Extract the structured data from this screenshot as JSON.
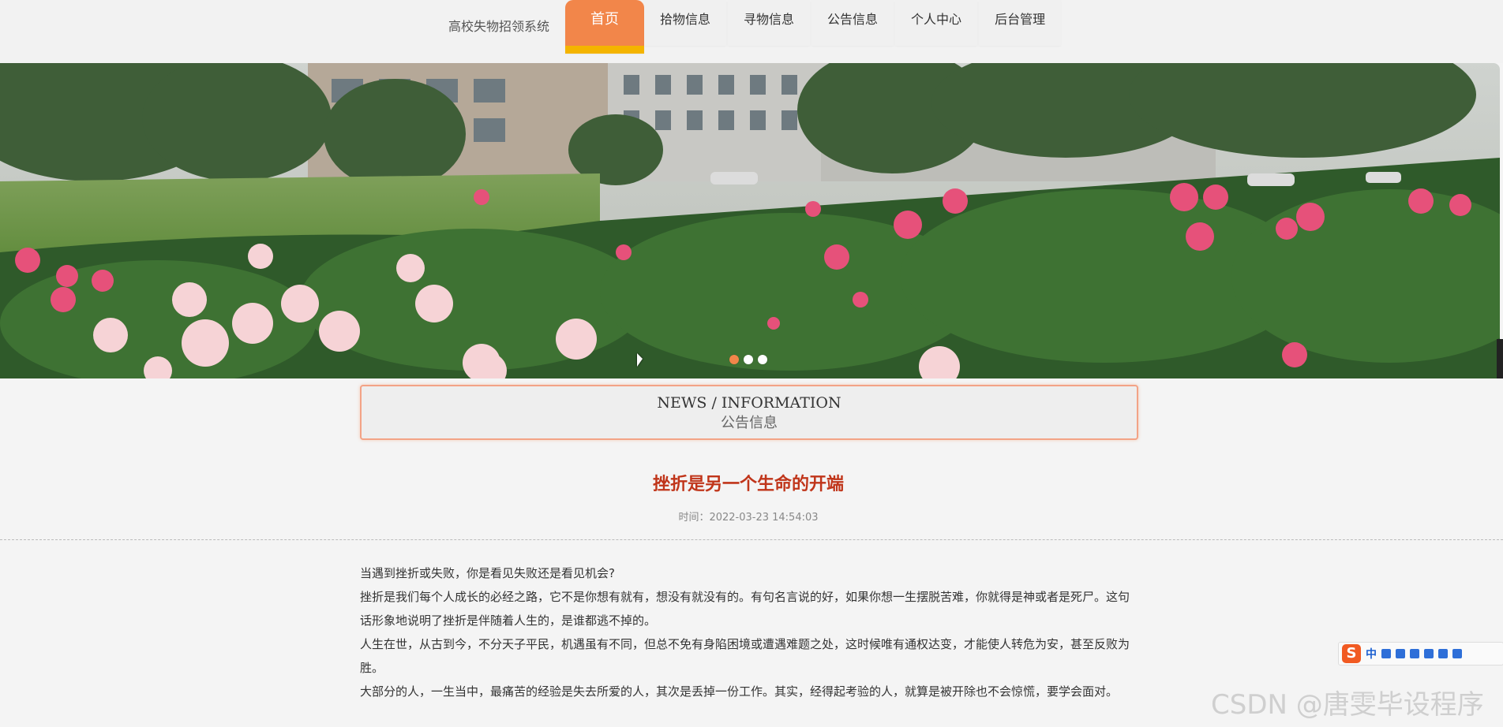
{
  "header": {
    "site_title": "高校失物招领系统",
    "nav": [
      {
        "label": "首页",
        "active": true
      },
      {
        "label": "拾物信息",
        "active": false
      },
      {
        "label": "寻物信息",
        "active": false
      },
      {
        "label": "公告信息",
        "active": false
      },
      {
        "label": "个人中心",
        "active": false
      },
      {
        "label": "后台管理",
        "active": false
      }
    ]
  },
  "banner": {
    "image": "campus-peony-garden-photo",
    "slides": 3,
    "active_slide": 1
  },
  "section": {
    "title_en": "NEWS / INFORMATION",
    "title_cn": "公告信息"
  },
  "article": {
    "title": "挫折是另一个生命的开端",
    "time": "时间：2022-03-23 14:54:03",
    "paragraphs": [
      "当遇到挫折或失败，你是看见失败还是看见机会?",
      "挫折是我们每个人成长的必经之路，它不是你想有就有，想没有就没有的。有句名言说的好，如果你想一生摆脱苦难，你就得是神或者是死尸。这句话形象地说明了挫折是伴随着人生的，是谁都逃不掉的。",
      "人生在世，从古到今，不分天子平民，机遇虽有不同，但总不免有身陷困境或遭遇难题之处，这时候唯有通权达变，才能使人转危为安，甚至反败为胜。",
      "大部分的人，一生当中，最痛苦的经验是失去所爱的人，其次是丢掉一份工作。其实，经得起考验的人，就算是被开除也不会惊慌，要学会面对。"
    ]
  },
  "ime": {
    "logo": "S",
    "lang": "中"
  },
  "watermark": "CSDN @唐雯毕设程序",
  "colors": {
    "accent": "#f2864a",
    "accent_underline": "#f4b400",
    "title_red": "#c0351a"
  }
}
